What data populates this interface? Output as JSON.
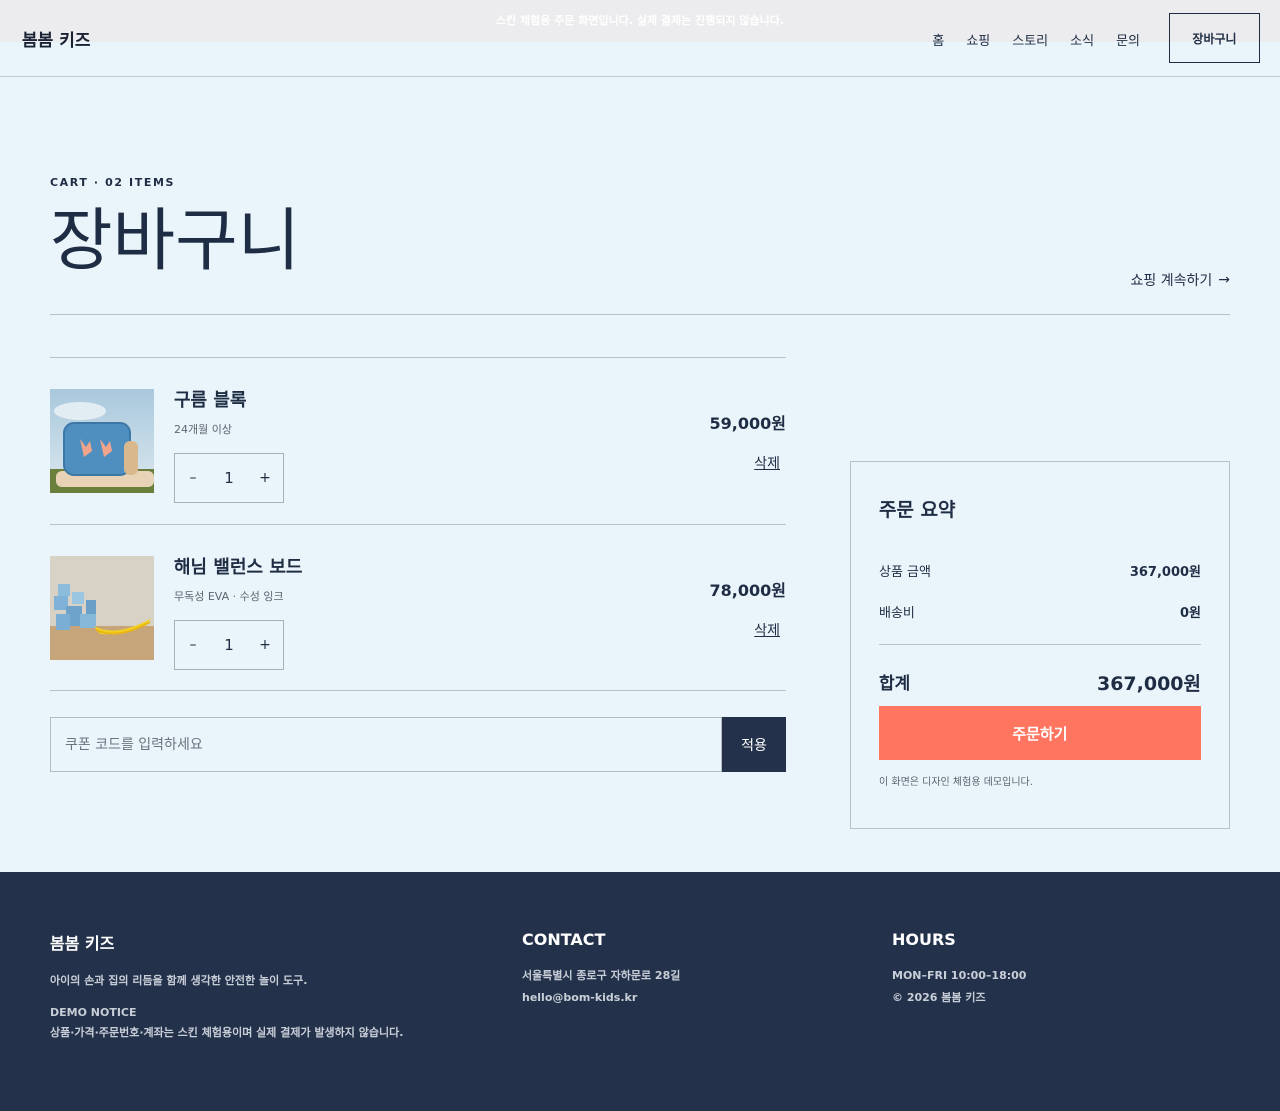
{
  "banner": {
    "text": "스킨 체험용 주문 화면입니다. 실제 결제는 진행되지 않습니다."
  },
  "header": {
    "logo": "봄봄 키즈",
    "nav": [
      "홈",
      "쇼핑",
      "스토리",
      "소식",
      "문의"
    ],
    "cart_button": "장바구니"
  },
  "page": {
    "eyebrow": "CART · 02 ITEMS",
    "title": "장바구니",
    "continue_link": "쇼핑 계속하기",
    "continue_icon": "arrow-right-icon"
  },
  "cart": {
    "items": [
      {
        "name": "구름 블록",
        "meta": "24개월 이상",
        "quantity": "1",
        "price": "59,000원",
        "remove_label": "삭제",
        "minus": "–",
        "plus": "+"
      },
      {
        "name": "해님 밸런스 보드",
        "meta": "무독성 EVA · 수성 잉크",
        "quantity": "1",
        "price": "78,000원",
        "remove_label": "삭제",
        "minus": "–",
        "plus": "+"
      }
    ],
    "coupon": {
      "placeholder": "쿠폰 코드를 입력하세요",
      "button": "적용"
    }
  },
  "summary": {
    "title": "주문 요약",
    "subtotal_label": "상품 금액",
    "subtotal_value": "367,000원",
    "shipping_label": "배송비",
    "shipping_value": "0원",
    "total_label": "합계",
    "total_value": "367,000원",
    "order_button": "주문하기",
    "note": "이 화면은 디자인 체험용 데모입니다."
  },
  "footer": {
    "brand": {
      "title": "봄봄 키즈",
      "tagline": "아이의 손과 집의 리듬을 함께 생각한 안전한 놀이 도구.",
      "notice_title": "DEMO NOTICE",
      "notice_text": "상품·가격·주문번호·계좌는 스킨 체험용이며 실제 결제가 발생하지 않습니다."
    },
    "contact": {
      "title": "CONTACT",
      "address": "서울특별시 종로구 자하문로 28길",
      "email": "hello@bom-kids.kr"
    },
    "hours": {
      "title": "HOURS",
      "time": "MON–FRI 10:00–18:00",
      "copyright": "© 2026 봄봄 키즈"
    }
  },
  "colors": {
    "background": "#eaf5fb",
    "navy": "#23324a",
    "accent": "#ff7560"
  }
}
